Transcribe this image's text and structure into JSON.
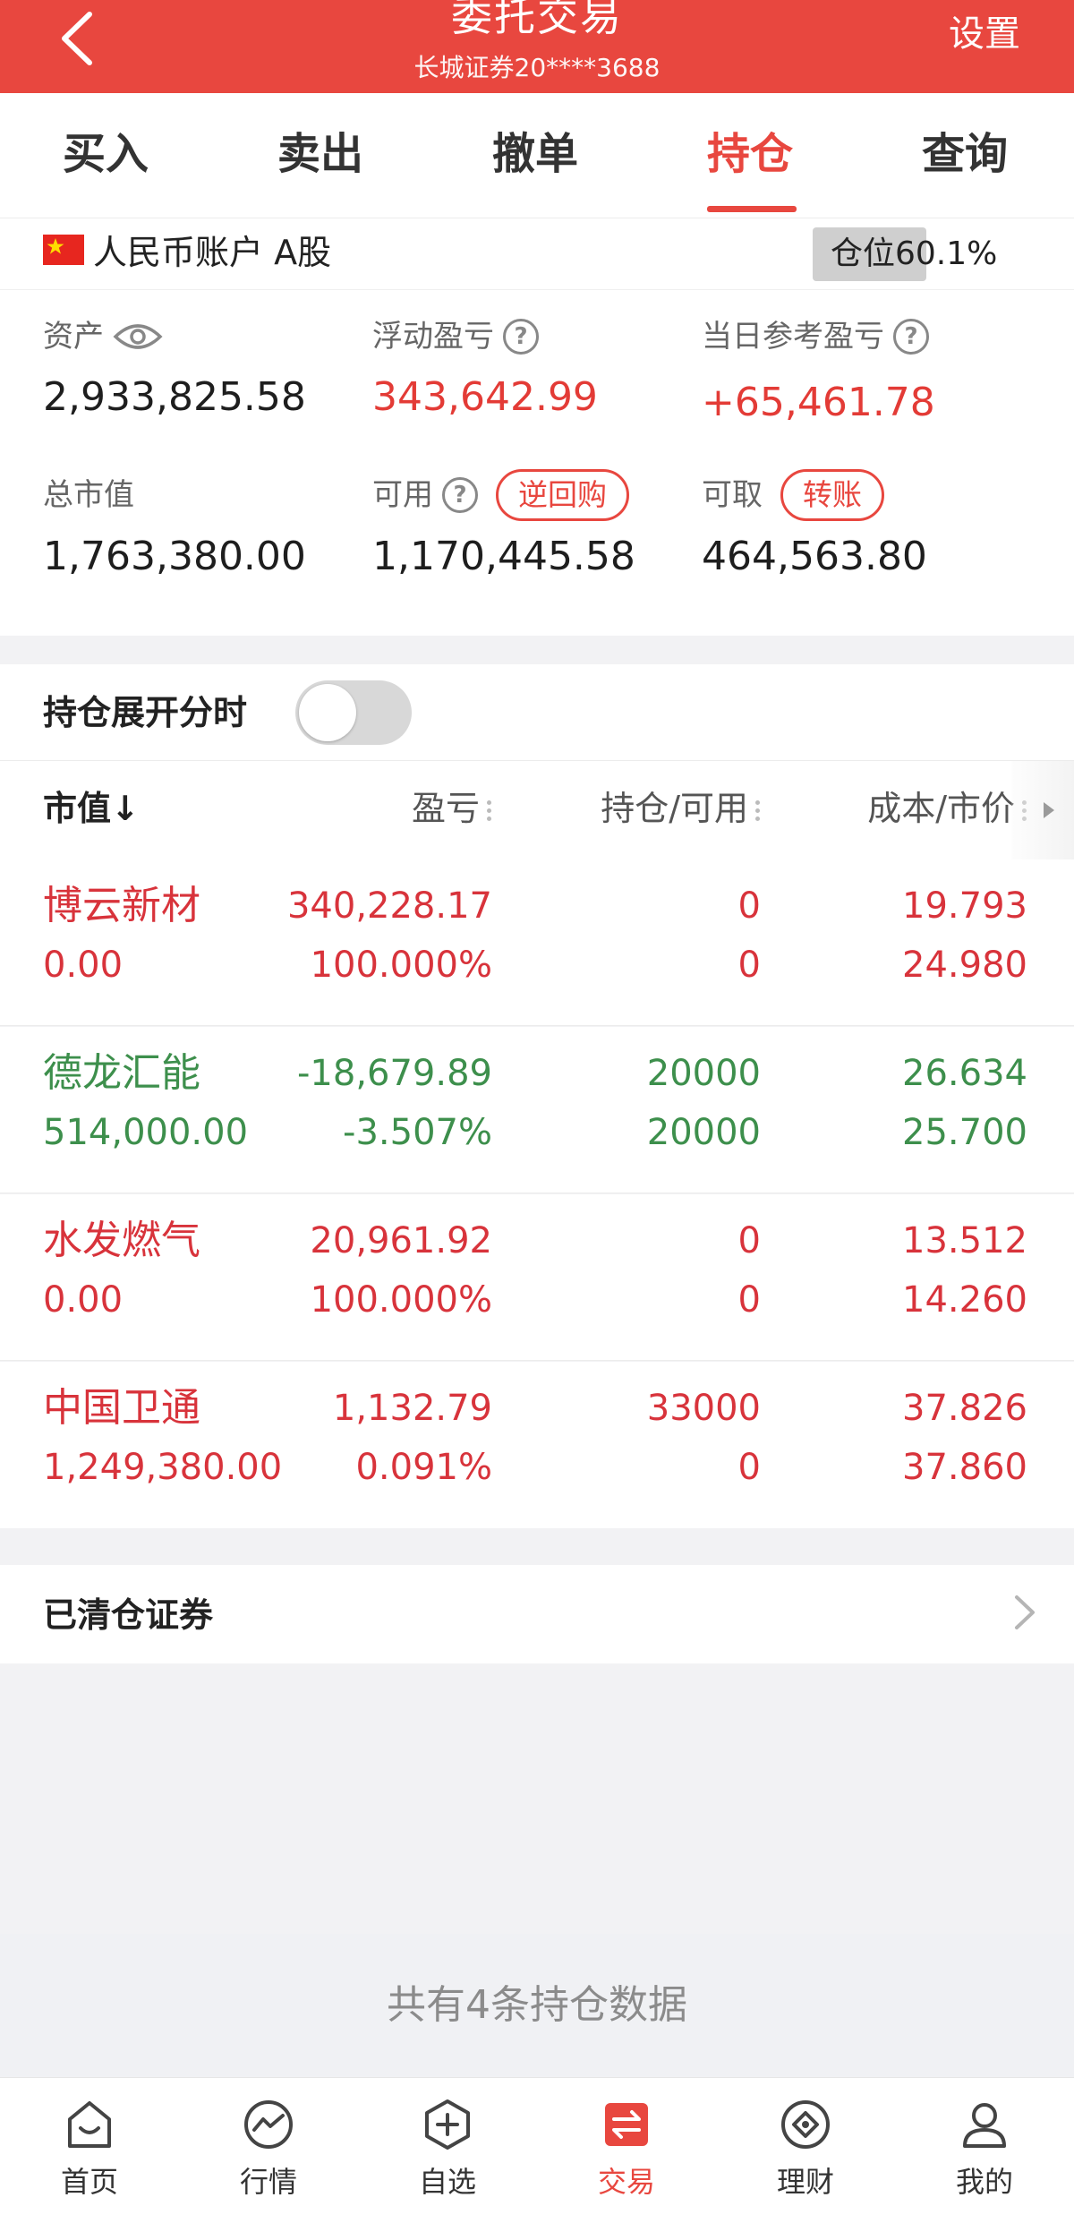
{
  "header": {
    "title": "委托交易",
    "subtitle": "长城证券20****3688",
    "settings_label": "设置"
  },
  "tabs": [
    {
      "label": "买入",
      "active": false
    },
    {
      "label": "卖出",
      "active": false
    },
    {
      "label": "撤单",
      "active": false
    },
    {
      "label": "持仓",
      "active": true
    },
    {
      "label": "查询",
      "active": false
    }
  ],
  "account": {
    "label": "人民币账户 A股",
    "position_label": "仓位60.1%",
    "position_pct": 60.1
  },
  "assets": {
    "asset": {
      "label": "资产",
      "value": "2,933,825.58"
    },
    "floating_pnl": {
      "label": "浮动盈亏",
      "value": "343,642.99"
    },
    "day_pnl": {
      "label": "当日参考盈亏",
      "value": "+65,461.78"
    },
    "market_value": {
      "label": "总市值",
      "value": "1,763,380.00"
    },
    "available": {
      "label": "可用",
      "value": "1,170,445.58",
      "button": "逆回购"
    },
    "withdrawable": {
      "label": "可取",
      "value": "464,563.80",
      "button": "转账"
    }
  },
  "expand": {
    "label": "持仓展开分时",
    "enabled": false
  },
  "table": {
    "headers": {
      "market_value": "市值",
      "pnl": "盈亏",
      "hold": "持仓/可用",
      "cost": "成本/市价"
    },
    "rows": [
      {
        "name": "博云新材",
        "market_value": "0.00",
        "pnl": "340,228.17",
        "pct": "100.000%",
        "hold": "0",
        "avail": "0",
        "cost": "19.793",
        "price": "24.980",
        "color": "red"
      },
      {
        "name": "德龙汇能",
        "market_value": "514,000.00",
        "pnl": "-18,679.89",
        "pct": "-3.507%",
        "hold": "20000",
        "avail": "20000",
        "cost": "26.634",
        "price": "25.700",
        "color": "green"
      },
      {
        "name": "水发燃气",
        "market_value": "0.00",
        "pnl": "20,961.92",
        "pct": "100.000%",
        "hold": "0",
        "avail": "0",
        "cost": "13.512",
        "price": "14.260",
        "color": "red"
      },
      {
        "name": "中国卫通",
        "market_value": "1,249,380.00",
        "pnl": "1,132.79",
        "pct": "0.091%",
        "hold": "33000",
        "avail": "0",
        "cost": "37.826",
        "price": "37.860",
        "color": "red"
      }
    ]
  },
  "cleared": {
    "label": "已清仓证券"
  },
  "summary": "共有4条持仓数据",
  "bottom_nav": [
    {
      "label": "首页",
      "icon": "home-icon",
      "active": false
    },
    {
      "label": "行情",
      "icon": "market-icon",
      "active": false
    },
    {
      "label": "自选",
      "icon": "watchlist-icon",
      "active": false
    },
    {
      "label": "交易",
      "icon": "trade-icon",
      "active": true
    },
    {
      "label": "理财",
      "icon": "finance-icon",
      "active": false
    },
    {
      "label": "我的",
      "icon": "profile-icon",
      "active": false
    }
  ],
  "colors": {
    "brand": "#e8473f",
    "up": "#d8333b",
    "down": "#3d8f4c"
  }
}
